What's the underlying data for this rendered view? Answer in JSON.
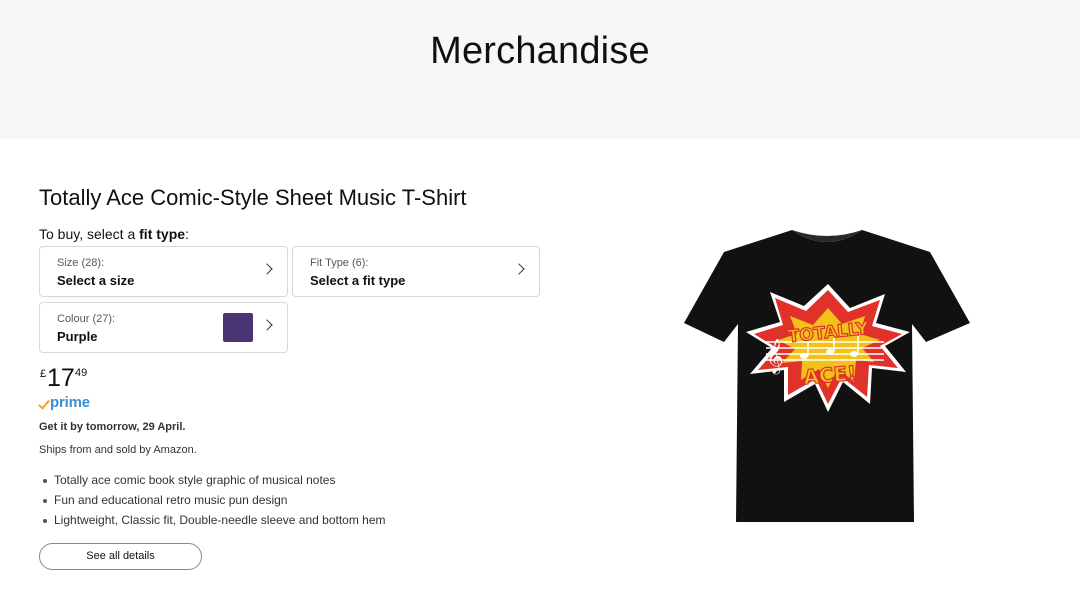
{
  "banner": {
    "title": "Merchandise"
  },
  "product": {
    "title": "Totally Ace Comic-Style Sheet Music T-Shirt",
    "buy_prefix": "To buy, select a ",
    "buy_bold": "fit type",
    "buy_suffix": ":",
    "selectors": {
      "size": {
        "label": "Size (28):",
        "value": "Select a size"
      },
      "fit": {
        "label": "Fit Type (6):",
        "value": "Select a fit type"
      },
      "colour": {
        "label": "Colour (27):",
        "value": "Purple",
        "swatch_color": "#4b3474"
      }
    },
    "price": {
      "symbol": "£",
      "whole": "17",
      "fraction": "49"
    },
    "prime": {
      "label": "prime",
      "check_color": "#f7a01b",
      "text_color": "#3b8fd0"
    },
    "delivery": "Get it by tomorrow, 29 April.",
    "ships": "Ships from and sold by Amazon.",
    "bullets": [
      "Totally ace comic book style graphic of musical notes",
      "Fun and educational retro music pun design",
      "Lightweight, Classic fit, Double-needle sleeve and bottom hem"
    ],
    "details_button": "See all details",
    "image": {
      "shirt_color": "#111111",
      "graphic_text_1": "TOTALLY",
      "graphic_text_2": "ACE!"
    }
  }
}
